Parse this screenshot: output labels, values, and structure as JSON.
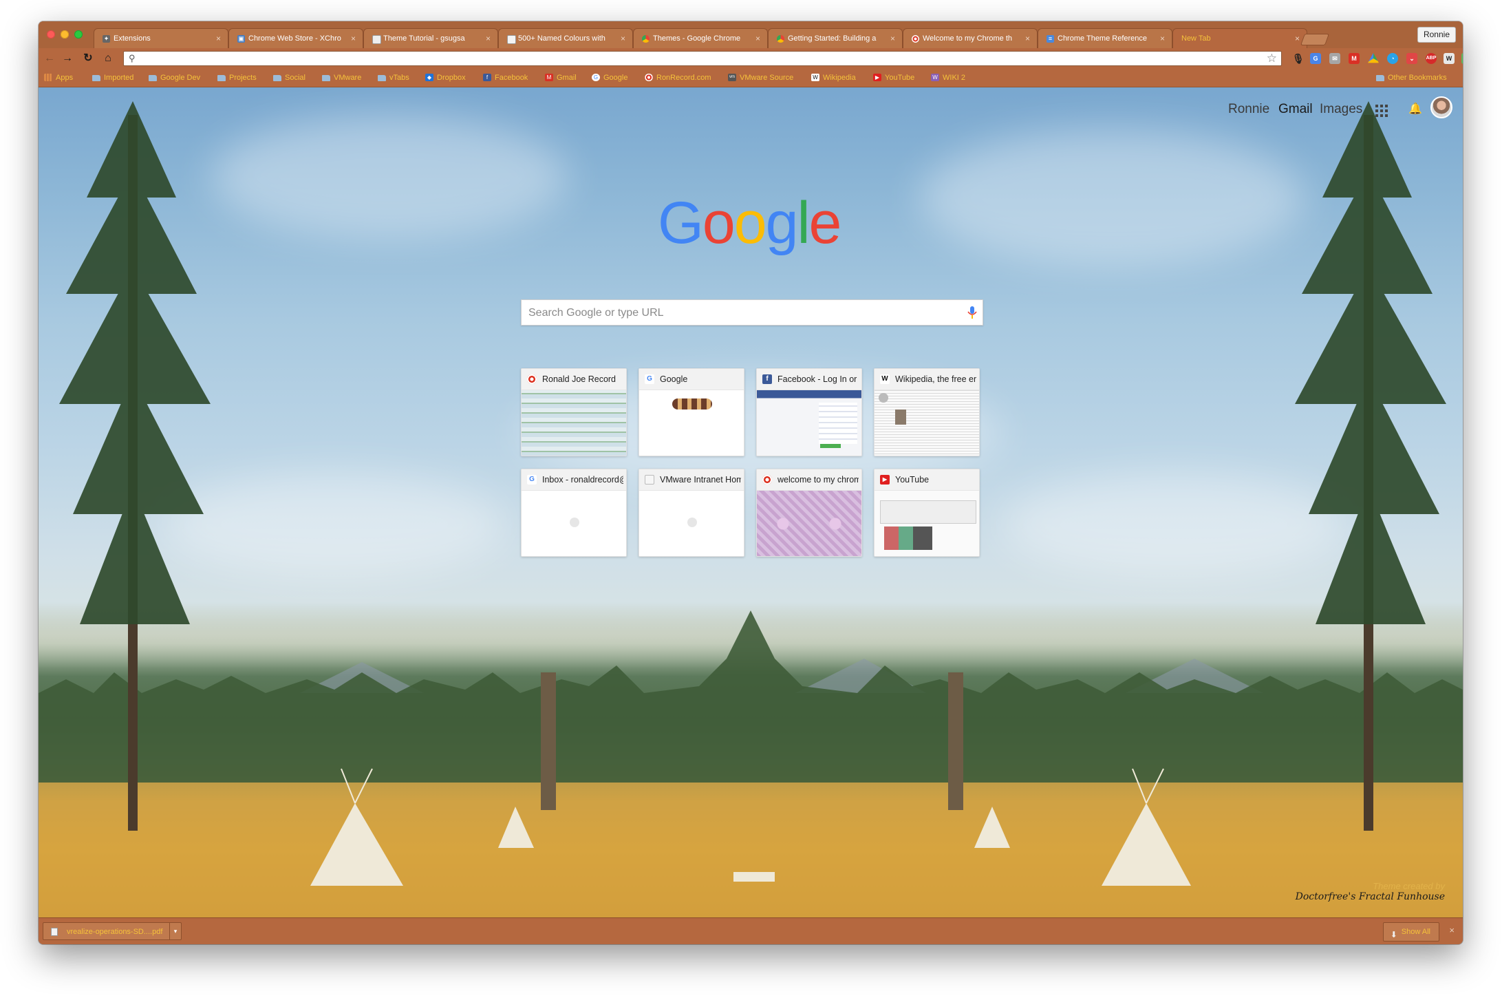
{
  "browser": {
    "profile_name": "Ronnie",
    "tabs": [
      {
        "title": "Extensions",
        "icon": "puzzle-icon",
        "active": false
      },
      {
        "title": "Chrome Web Store - XChro",
        "icon": "webstore-icon",
        "active": false
      },
      {
        "title": "Theme Tutorial - gsugsa",
        "icon": "page-icon",
        "active": false
      },
      {
        "title": "500+ Named Colours with",
        "icon": "page-icon",
        "active": false
      },
      {
        "title": "Themes - Google Chrome",
        "icon": "chrome-icon",
        "active": false
      },
      {
        "title": "Getting Started: Building a",
        "icon": "chrome-icon",
        "active": false
      },
      {
        "title": "Welcome to my Chrome th",
        "icon": "target-icon",
        "active": false
      },
      {
        "title": "Chrome Theme Reference",
        "icon": "doc-icon",
        "active": false
      },
      {
        "title": "New Tab",
        "icon": "",
        "active": true
      }
    ],
    "omnibox_value": "",
    "bookmarks": [
      {
        "label": "Apps",
        "icon": "apps-icon"
      },
      {
        "label": "Imported",
        "icon": "folder-icon"
      },
      {
        "label": "Google Dev",
        "icon": "folder-icon"
      },
      {
        "label": "Projects",
        "icon": "folder-icon"
      },
      {
        "label": "Social",
        "icon": "folder-icon"
      },
      {
        "label": "VMware",
        "icon": "folder-icon"
      },
      {
        "label": "vTabs",
        "icon": "folder-icon"
      },
      {
        "label": "Dropbox",
        "icon": "dropbox-icon"
      },
      {
        "label": "Facebook",
        "icon": "facebook-icon"
      },
      {
        "label": "Gmail",
        "icon": "gmail-icon"
      },
      {
        "label": "Google",
        "icon": "google-icon"
      },
      {
        "label": "RonRecord.com",
        "icon": "target-icon"
      },
      {
        "label": "VMware Source",
        "icon": "vmware-icon"
      },
      {
        "label": "Wikipedia",
        "icon": "wikipedia-icon"
      },
      {
        "label": "YouTube",
        "icon": "youtube-icon"
      },
      {
        "label": "WIKI 2",
        "icon": "wiki2-icon"
      }
    ],
    "other_bookmarks": "Other Bookmarks",
    "extensions": [
      "mic-icon",
      "translate-icon",
      "mail-icon",
      "gmail-icon",
      "drive-icon",
      "chat-icon",
      "pocket-icon",
      "adblock-icon",
      "wiki-icon",
      "evernote-icon",
      "lastpass-icon",
      "menu-icon"
    ],
    "adblock_label": "ABP",
    "ext_w_label": "W"
  },
  "newtab": {
    "header_links": {
      "user": "Ronnie",
      "gmail": "Gmail",
      "images": "Images"
    },
    "logo_text": [
      "G",
      "o",
      "o",
      "g",
      "l",
      "e"
    ],
    "logo_colors": [
      "#4285F4",
      "#EA4335",
      "#FBBC05",
      "#4285F4",
      "#34A853",
      "#EA4335"
    ],
    "search_placeholder": "Search Google or type URL",
    "tiles": [
      {
        "title": "Ronald Joe Record",
        "icon": "target-icon"
      },
      {
        "title": "Google",
        "icon": "google-icon"
      },
      {
        "title": "Facebook - Log In or",
        "icon": "facebook-icon"
      },
      {
        "title": "Wikipedia, the free en",
        "icon": "wikipedia-icon"
      },
      {
        "title": "Inbox - ronaldrecord@",
        "icon": "google-icon"
      },
      {
        "title": "VMware Intranet Hom",
        "icon": "page-icon"
      },
      {
        "title": "welcome to my chrom",
        "icon": "target-icon"
      },
      {
        "title": "YouTube",
        "icon": "youtube-icon"
      }
    ],
    "theme_credit_line1": "Theme created by",
    "theme_credit_line2": "Doctorfree's Fractal Funhouse"
  },
  "downloads": {
    "file_name": "vrealize-operations-SD....pdf",
    "show_all": "Show All"
  },
  "colors": {
    "frame": "#a9643b",
    "toolbar": "#b5683f",
    "bookmark_text": "#f5c23b",
    "active_tab_text": "#f5c23b"
  }
}
